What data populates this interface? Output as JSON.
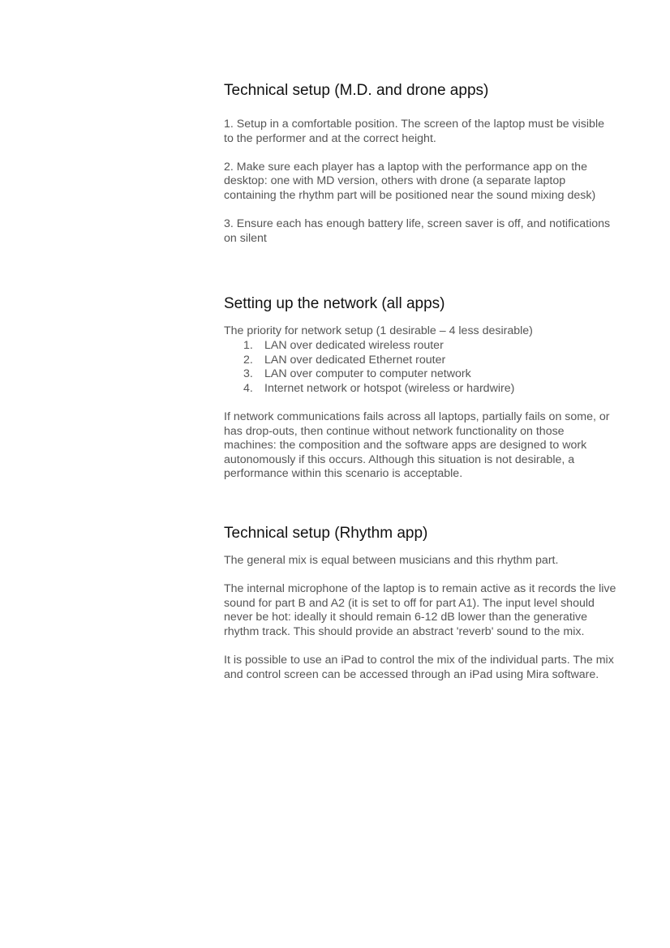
{
  "sections": [
    {
      "heading": "Technical setup (M.D. and drone apps)",
      "paragraphs": [
        "1. Setup in a comfortable position. The screen of the laptop must be visible to the performer and at the correct height.",
        "2. Make sure each player has a laptop with the performance app on the desktop: one with MD version, others with drone (a separate laptop containing the rhythm part will be positioned near the sound mixing desk)",
        "3. Ensure each has enough battery life, screen saver is off, and notifications on silent"
      ]
    },
    {
      "heading": "Setting up the network (all apps)",
      "intro": "The priority for network setup (1 desirable – 4 less desirable)",
      "list": [
        {
          "num": "1.",
          "text": "LAN over dedicated wireless router"
        },
        {
          "num": "2.",
          "text": "LAN over dedicated Ethernet router"
        },
        {
          "num": "3.",
          "text": "LAN over computer to computer network"
        },
        {
          "num": "4.",
          "text": "Internet network or hotspot (wireless or hardwire)"
        }
      ],
      "after": "If network communications fails across all laptops, partially fails on some, or has drop-outs, then continue without network functionality on those machines: the composition and the software apps are designed to work autonomously if this occurs. Although this situation is not desirable, a performance within this scenario is acceptable."
    },
    {
      "heading": "Technical setup (Rhythm app)",
      "paragraphs": [
        "The general mix is equal between musicians and this rhythm part.",
        "The internal microphone of the laptop is to remain active as it records the live sound for part B and A2 (it is set to off for part A1). The input level should never be hot: ideally it should remain 6-12 dB lower than the generative rhythm track. This should provide an abstract 'reverb' sound to the mix.",
        "It is possible to use an iPad to control the mix of the individual parts. The mix and control screen can be accessed through an iPad using Mira software."
      ]
    }
  ]
}
